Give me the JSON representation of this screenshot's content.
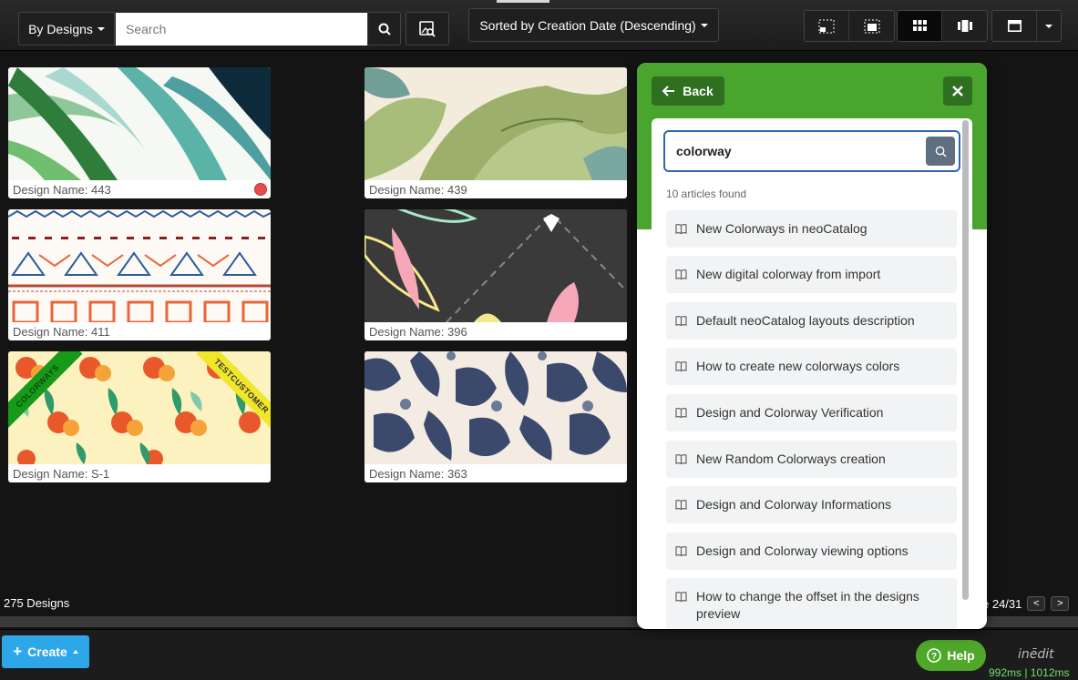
{
  "toolbar": {
    "filter_label": "By Designs",
    "search_placeholder": "Search",
    "sort_label": "Sorted by Creation Date (Descending)"
  },
  "designs": [
    {
      "caption": "Design Name: 443",
      "status_color": "#e84c4c"
    },
    {
      "caption": "Design Name: 439"
    },
    {
      "caption": "Design Name: 411"
    },
    {
      "caption": "Design Name: 396"
    },
    {
      "caption": "Design Name: S-1",
      "ribbons": [
        "COLORWAYS",
        "TESTCUSTOMER"
      ]
    },
    {
      "caption": "Design Name: 363"
    }
  ],
  "footer": {
    "count": "275 Designs",
    "page": "e 24/31",
    "prev": "<",
    "next": ">",
    "create_label": "Create",
    "help_label": "Help",
    "logo": "inēdit",
    "timing": "992ms | 1012ms"
  },
  "help_panel": {
    "back_label": "Back",
    "search_value": "colorway",
    "results_count": "10 articles found",
    "articles": [
      "New Colorways in neoCatalog",
      "New digital colorway from import",
      "Default neoCatalog layouts description",
      "How to create new colorways colors",
      "Design and Colorway Verification",
      "New Random Colorways creation",
      "Design and Colorway Informations",
      "Design and Colorway viewing options",
      "How to change the offset in the designs preview"
    ]
  },
  "colors": {
    "accent_green": "#4aa52e",
    "create_blue": "#2ea7e8",
    "status_red": "#e84c4c"
  }
}
